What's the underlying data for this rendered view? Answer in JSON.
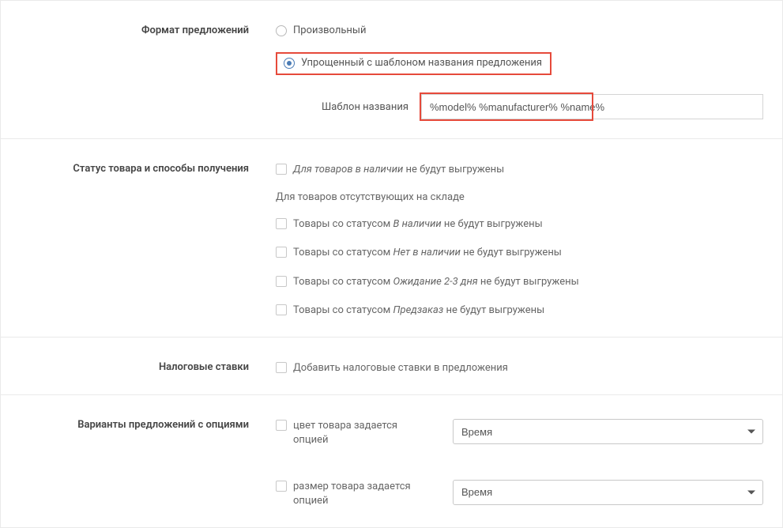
{
  "offerFormat": {
    "label": "Формат предложений",
    "options": {
      "arbitrary": "Произвольный",
      "simplified": "Упрощенный с шаблоном названия предложения"
    },
    "selected": "simplified",
    "templateLabel": "Шаблон названия",
    "templateValue": "%model% %manufacturer% %name%"
  },
  "productStatus": {
    "label": "Статус товара и способы получения",
    "inStockNotExported": {
      "prefix": "Для товаров в наличии",
      "suffix": " не будут выгружены"
    },
    "outOfStockHeading": "Для товаров отсутствующих на складе",
    "statusLines": [
      {
        "prefix": "Товары со статусом ",
        "status": "В наличии",
        "suffix": " не будут выгружены"
      },
      {
        "prefix": "Товары со статусом ",
        "status": "Нет в наличии",
        "suffix": " не будут выгружены"
      },
      {
        "prefix": "Товары со статусом ",
        "status": "Ожидание 2-3 дня",
        "suffix": " не будут выгружены"
      },
      {
        "prefix": "Товары со статусом ",
        "status": "Предзаказ",
        "suffix": " не будут выгружены"
      }
    ]
  },
  "taxRates": {
    "label": "Налоговые ставки",
    "checkboxLabel": "Добавить налоговые ставки в предложения"
  },
  "optionVariants": {
    "label": "Варианты предложений с опциями",
    "colorCheckbox": "цвет товара задается опцией",
    "sizeCheckbox": "размер товара задается опцией",
    "selectValueColor": "Время",
    "selectValueSize": "Время"
  }
}
